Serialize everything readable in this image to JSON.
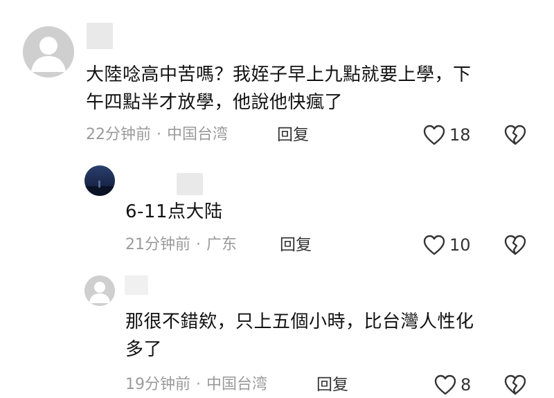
{
  "comments": [
    {
      "text_lines": [
        "大陸唸高中苦嗎？我姪子早上九點就要上學，下",
        "午四點半才放學，他說他快瘋了"
      ],
      "time": "22分钟前",
      "location": "中国台湾",
      "reply_label": "回复",
      "likes": "18",
      "avatar": "default-user-avatar"
    },
    {
      "text_lines": [
        "6-11点大陆"
      ],
      "time": "21分钟前",
      "location": "广东",
      "reply_label": "回复",
      "likes": "10",
      "avatar": "night-scene-avatar"
    },
    {
      "text_lines": [
        "那很不錯欸，只上五個小時，比台灣人性化",
        "多了"
      ],
      "time": "19分钟前",
      "location": "中国台湾",
      "reply_label": "回复",
      "likes": "8",
      "avatar": "default-user-avatar"
    }
  ],
  "icons": {
    "like": "heart-outline-icon",
    "dislike": "broken-heart-icon"
  },
  "colors": {
    "meta_gray": "#9a9a9a",
    "avatar_gray": "#c8c8c8",
    "night_avatar": "#1e2f56"
  }
}
